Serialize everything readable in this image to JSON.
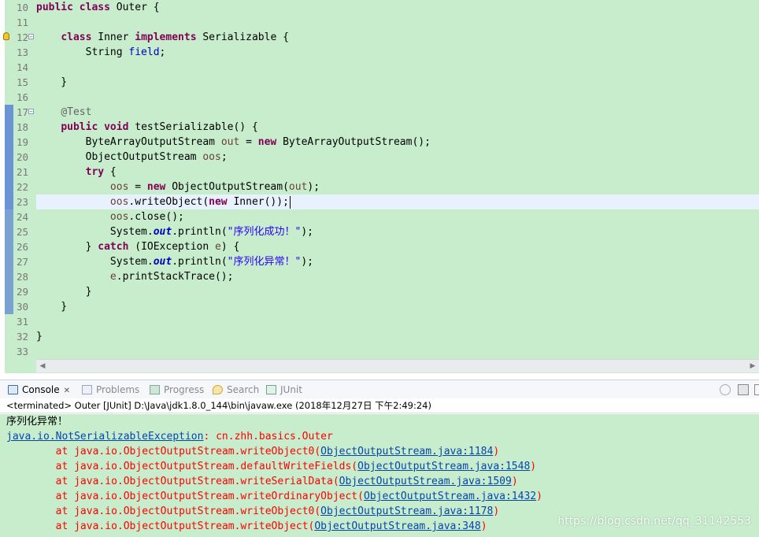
{
  "editor": {
    "lines": [
      {
        "num": "10",
        "tokens": [
          [
            "kw",
            "public"
          ],
          [
            "t",
            " "
          ],
          [
            "kw",
            "class"
          ],
          [
            "t",
            " Outer {"
          ]
        ]
      },
      {
        "num": "11",
        "tokens": []
      },
      {
        "num": "12",
        "tokens": [
          [
            "t",
            "    "
          ],
          [
            "kw",
            "class"
          ],
          [
            "t",
            " Inner "
          ],
          [
            "kw",
            "implements"
          ],
          [
            "t",
            " Serializable {"
          ]
        ]
      },
      {
        "num": "13",
        "tokens": [
          [
            "t",
            "        String "
          ],
          [
            "fld",
            "field"
          ],
          [
            "t",
            ";"
          ]
        ]
      },
      {
        "num": "14",
        "tokens": []
      },
      {
        "num": "15",
        "tokens": [
          [
            "t",
            "    }"
          ]
        ]
      },
      {
        "num": "16",
        "tokens": []
      },
      {
        "num": "17",
        "tokens": [
          [
            "t",
            "    "
          ],
          [
            "ann",
            "@Test"
          ]
        ]
      },
      {
        "num": "18",
        "tokens": [
          [
            "t",
            "    "
          ],
          [
            "kw",
            "public"
          ],
          [
            "t",
            " "
          ],
          [
            "kw",
            "void"
          ],
          [
            "t",
            " testSerializable() {"
          ]
        ]
      },
      {
        "num": "19",
        "tokens": [
          [
            "t",
            "        ByteArrayOutputStream "
          ],
          [
            "var",
            "out"
          ],
          [
            "t",
            " = "
          ],
          [
            "kw",
            "new"
          ],
          [
            "t",
            " ByteArrayOutputStream();"
          ]
        ]
      },
      {
        "num": "20",
        "tokens": [
          [
            "t",
            "        ObjectOutputStream "
          ],
          [
            "var",
            "oos"
          ],
          [
            "t",
            ";"
          ]
        ]
      },
      {
        "num": "21",
        "tokens": [
          [
            "t",
            "        "
          ],
          [
            "kw",
            "try"
          ],
          [
            "t",
            " {"
          ]
        ]
      },
      {
        "num": "22",
        "tokens": [
          [
            "t",
            "            "
          ],
          [
            "var",
            "oos"
          ],
          [
            "t",
            " = "
          ],
          [
            "kw",
            "new"
          ],
          [
            "t",
            " ObjectOutputStream("
          ],
          [
            "var",
            "out"
          ],
          [
            "t",
            ");"
          ]
        ]
      },
      {
        "num": "23",
        "tokens": [
          [
            "t",
            "            "
          ],
          [
            "var",
            "oos"
          ],
          [
            "t",
            ".writeObject("
          ],
          [
            "kw",
            "new"
          ],
          [
            "t",
            " Inner());"
          ]
        ]
      },
      {
        "num": "24",
        "tokens": [
          [
            "t",
            "            "
          ],
          [
            "var",
            "oos"
          ],
          [
            "t",
            ".close();"
          ]
        ]
      },
      {
        "num": "25",
        "tokens": [
          [
            "t",
            "            System."
          ],
          [
            "sfld",
            "out"
          ],
          [
            "t",
            ".println("
          ],
          [
            "str",
            "\"序列化成功！\""
          ],
          [
            "t",
            ");"
          ]
        ]
      },
      {
        "num": "26",
        "tokens": [
          [
            "t",
            "        } "
          ],
          [
            "kw",
            "catch"
          ],
          [
            "t",
            " (IOException "
          ],
          [
            "var",
            "e"
          ],
          [
            "t",
            ") {"
          ]
        ]
      },
      {
        "num": "27",
        "tokens": [
          [
            "t",
            "            System."
          ],
          [
            "sfld",
            "out"
          ],
          [
            "t",
            ".println("
          ],
          [
            "str",
            "\"序列化异常！\""
          ],
          [
            "t",
            ");"
          ]
        ]
      },
      {
        "num": "28",
        "tokens": [
          [
            "t",
            "            "
          ],
          [
            "var",
            "e"
          ],
          [
            "t",
            ".printStackTrace();"
          ]
        ]
      },
      {
        "num": "29",
        "tokens": [
          [
            "t",
            "        }"
          ]
        ]
      },
      {
        "num": "30",
        "tokens": [
          [
            "t",
            "    }"
          ]
        ]
      },
      {
        "num": "31",
        "tokens": []
      },
      {
        "num": "32",
        "tokens": [
          [
            "t",
            "}"
          ]
        ]
      },
      {
        "num": "33",
        "tokens": []
      }
    ],
    "current_line": "23",
    "fold_lines": [
      "12",
      "17"
    ]
  },
  "tabs": {
    "console": "Console",
    "console_close": "✕",
    "problems": "Problems",
    "progress": "Progress",
    "search": "Search",
    "junit": "JUnit"
  },
  "console": {
    "header": "<terminated> Outer [JUnit] D:\\Java\\jdk1.8.0_144\\bin\\javaw.exe (2018年12月27日 下午2:49:24)",
    "stdout_line": "序列化异常！",
    "exception_class": "java.io.NotSerializableException",
    "exception_message": ": cn.zhh.basics.Outer",
    "stack": [
      {
        "prefix": "\tat java.io.ObjectOutputStream.writeObject0(",
        "link": "ObjectOutputStream.java:1184",
        "suffix": ")"
      },
      {
        "prefix": "\tat java.io.ObjectOutputStream.defaultWriteFields(",
        "link": "ObjectOutputStream.java:1548",
        "suffix": ")"
      },
      {
        "prefix": "\tat java.io.ObjectOutputStream.writeSerialData(",
        "link": "ObjectOutputStream.java:1509",
        "suffix": ")"
      },
      {
        "prefix": "\tat java.io.ObjectOutputStream.writeOrdinaryObject(",
        "link": "ObjectOutputStream.java:1432",
        "suffix": ")"
      },
      {
        "prefix": "\tat java.io.ObjectOutputStream.writeObject0(",
        "link": "ObjectOutputStream.java:1178",
        "suffix": ")"
      },
      {
        "prefix": "\tat java.io.ObjectOutputStream.writeObject(",
        "link": "ObjectOutputStream.java:348",
        "suffix": ")"
      }
    ]
  },
  "watermark": "https://blog.csdn.net/qq_31142553"
}
